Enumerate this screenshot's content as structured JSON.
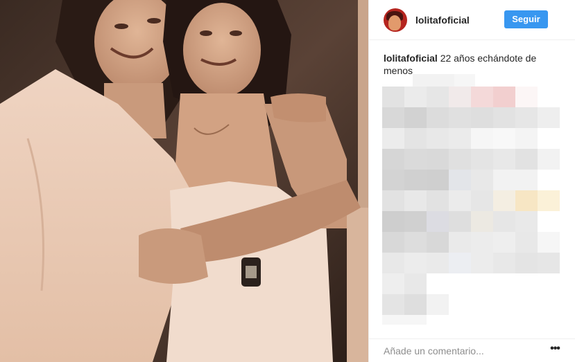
{
  "post": {
    "username": "lolitafoficial",
    "follow_label": "Seguir",
    "caption": {
      "username": "lolitafoficial",
      "text": "22 años echándote de menos"
    },
    "comment_placeholder": "Añade un comentario...",
    "more_label": "•••"
  },
  "colors": {
    "follow_button": "#3897f0",
    "photo_tint": "#d4b39b"
  },
  "icons": {
    "more": "ellipsis-icon"
  }
}
